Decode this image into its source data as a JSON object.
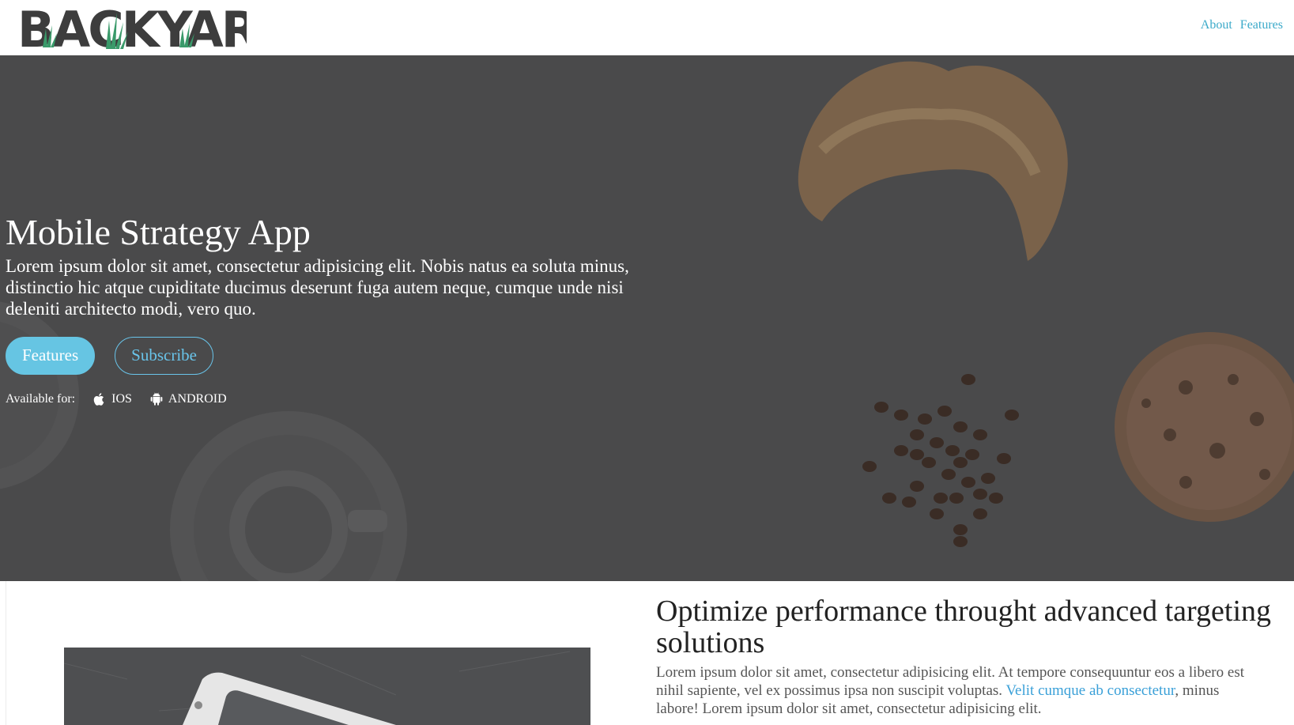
{
  "header": {
    "logo": "BACKYARD",
    "nav": [
      {
        "label": "About"
      },
      {
        "label": "Features"
      }
    ]
  },
  "hero": {
    "title": "Mobile Strategy App",
    "text": "Lorem ipsum dolor sit amet, consectetur adipisicing elit. Nobis natus ea soluta minus, distinctio hic atque cupiditate ducimus deserunt fuga autem neque, cumque unde nisi deleniti architecto modi, vero quo.",
    "primary_button": "Features",
    "secondary_button": "Subscribe",
    "available_label": "Available for:",
    "platforms": [
      {
        "label": "IOS",
        "icon": "apple-icon"
      },
      {
        "label": "ANDROID",
        "icon": "android-icon"
      }
    ]
  },
  "feature": {
    "title": "Optimize performance throught advanced targeting solutions",
    "text_before_link": "Lorem ipsum dolor sit amet, consectetur adipisicing elit. At tempore consequuntur eos a libero est nihil sapiente, vel ex possimus ipsa non suscipit voluptas. ",
    "link": "Velit cumque ab consectetur",
    "text_after_link": ", minus labore! Lorem ipsum dolor sit amet, consectetur adipisicing elit."
  },
  "colors": {
    "accent": "#66c5e3",
    "link": "#3aa9c9",
    "hero_bg": "#4a4a4b",
    "logo_grass": "#3a9a6a"
  }
}
